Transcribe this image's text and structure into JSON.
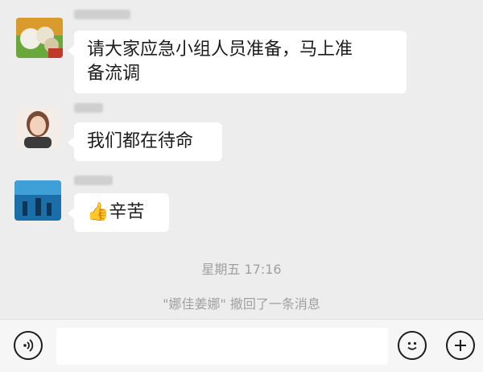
{
  "chat": {
    "messages": [
      {
        "sender": "",
        "avatar_desc": "food-photo-avatar",
        "lines": [
          "请大家应急小组人员准备，马上准",
          "备流调"
        ]
      },
      {
        "sender": "",
        "avatar_desc": "woman-portrait-avatar",
        "lines": [
          "我们都在待命"
        ]
      },
      {
        "sender": "",
        "avatar_desc": "aquarium-photo-avatar",
        "emoji": "👍",
        "lines": [
          "辛苦"
        ]
      }
    ],
    "timestamp": "星期五 17:16",
    "recall_notice": "\"娜佳姜娜\" 撤回了一条消息"
  },
  "input_bar": {
    "voice_icon": "voice-icon",
    "emoji_icon": "emoji-icon",
    "plus_icon": "plus-icon",
    "text_value": ""
  },
  "colors": {
    "background": "#ededed",
    "bubble": "#ffffff",
    "text": "#1c1c1c",
    "system_text": "#a0a0a0"
  }
}
